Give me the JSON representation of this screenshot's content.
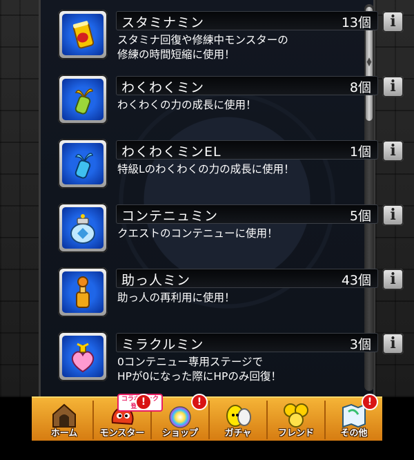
{
  "items": [
    {
      "name": "スタミナミン",
      "count": "13個",
      "desc": "スタミナ回復や修練中モンスターの\n修練の時間短縮に使用！",
      "icon": "stamina-can-icon"
    },
    {
      "name": "わくわくミン",
      "count": "8個",
      "desc": "わくわくの力の成長に使用！",
      "icon": "sprout-bottle-icon"
    },
    {
      "name": "わくわくミンEL",
      "count": "1個",
      "desc": "特級Lのわくわくの力の成長に使用！",
      "icon": "blue-bottle-icon"
    },
    {
      "name": "コンテニュミン",
      "count": "5個",
      "desc": "クエストのコンテニューに使用！",
      "icon": "jar-icon"
    },
    {
      "name": "助っ人ミン",
      "count": "43個",
      "desc": "助っ人の再利用に使用！",
      "icon": "helper-bottle-icon"
    },
    {
      "name": "ミラクルミン",
      "count": "3個",
      "desc": "0コンテニュー専用ステージで\nHPが0になった際にHPのみ回復！",
      "icon": "heart-bottle-icon"
    }
  ],
  "info_glyph": "i",
  "nav": {
    "home": "ホーム",
    "monster": "モンスター",
    "shop": "ショップ",
    "gacha": "ガチャ",
    "friend": "フレンド",
    "other": "その他",
    "badge": "!",
    "collab_line1": "コラボパック",
    "collab_line2": "登場！"
  },
  "colors": {
    "accent_orange": "#f5b437",
    "panel": "#121721",
    "badge_red": "#d81414"
  }
}
